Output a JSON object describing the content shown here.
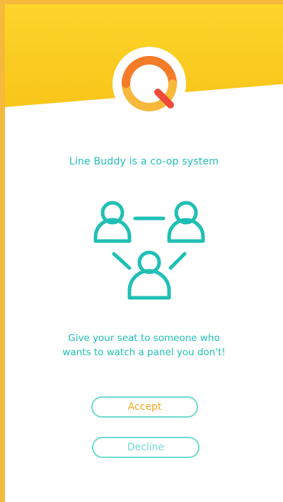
{
  "colors": {
    "frame": "#f6b93b",
    "header_yellow": "#fbd021",
    "accent_teal": "#1fbfb4",
    "button_border": "#6ddbd0",
    "accept_text": "#f6a623",
    "logo_orange": "#f47b2a",
    "logo_red": "#ef4b3a",
    "logo_yellow": "#f6b93b"
  },
  "header": {
    "logo_icon": "q-logo-icon"
  },
  "main": {
    "headline": "Line Buddy is a co-op system",
    "illustration_icon": "people-network-icon",
    "description_line1": "Give your seat to someone who",
    "description_line2": "wants to watch a panel you don't!"
  },
  "actions": {
    "accept_label": "Accept",
    "decline_label": "Decline"
  }
}
